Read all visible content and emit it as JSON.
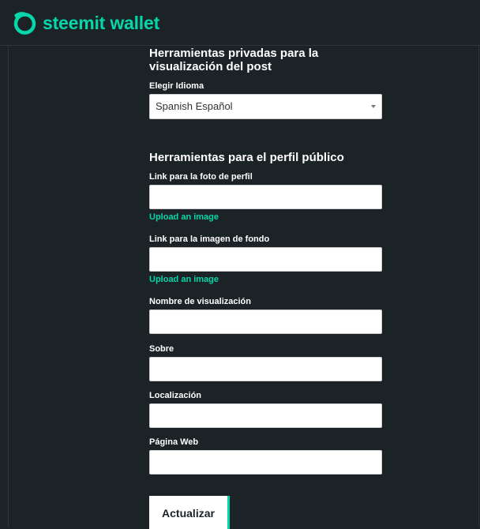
{
  "header": {
    "brand": "steemit wallet",
    "logo": "steemit-logo-icon",
    "accent": "#06d6a9"
  },
  "private_section": {
    "title_line1": "Herramientas privadas para la",
    "title_line2": "visualización del post",
    "language_label": "Elegir Idioma",
    "language_value": "Spanish Español"
  },
  "public_section": {
    "title": "Herramientas para el perfil público",
    "fields": [
      {
        "label": "Link para la foto de perfil",
        "value": "",
        "upload": "Upload an image"
      },
      {
        "label": "Link para la imagen de fondo",
        "value": "",
        "upload": "Upload an image"
      },
      {
        "label": "Nombre de visualización",
        "value": ""
      },
      {
        "label": "Sobre",
        "value": ""
      },
      {
        "label": "Localización",
        "value": ""
      },
      {
        "label": "Página Web",
        "value": ""
      }
    ]
  },
  "actions": {
    "submit_label": "Actualizar"
  }
}
